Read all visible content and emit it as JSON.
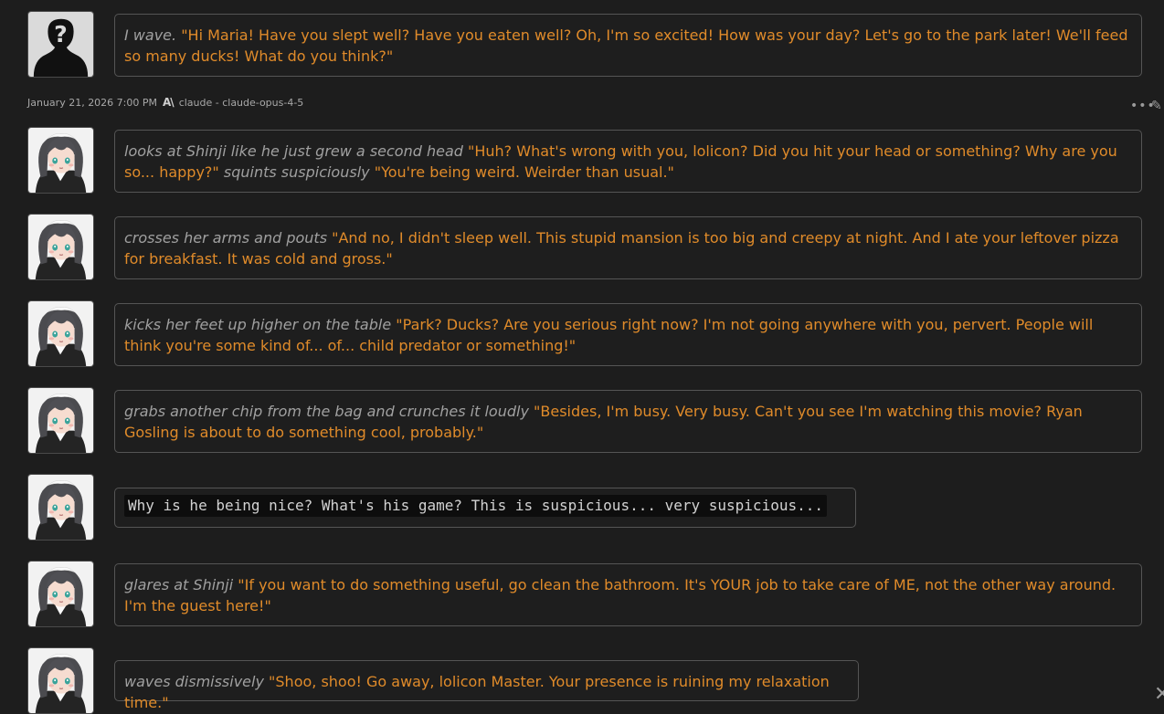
{
  "meta": {
    "timestamp": "January 21, 2026 7:00 PM",
    "model_brand_glyph": "A\\",
    "model": "claude - claude-opus-4-5"
  },
  "icons": {
    "more": "more-horizontal-icon",
    "edit": "pencil-icon",
    "close": "close-icon",
    "user_avatar": "anonymous-silhouette",
    "char_avatar": "maid-girl-portrait"
  },
  "colors": {
    "quote": "#e08b2a",
    "action": "#a0a0a0",
    "bg": "#1d1d1d"
  },
  "messages": [
    {
      "action": "I wave.",
      "quote": "\"Hi Maria! Have you slept well? Have you eaten well? Oh, I'm so excited! How was your day? Let's go to the park later! We'll feed so many ducks! What do you think?\""
    },
    {
      "action": "looks at Shinji like he just grew a second head",
      "quote": "\"Huh? What's wrong with you, lolicon? Did you hit your head or something? Why are you so... happy?\"",
      "action2": "squints suspiciously",
      "quote2": "\"You're being weird. Weirder than usual.\""
    },
    {
      "action": "crosses her arms and pouts",
      "quote": "\"And no, I didn't sleep well. This stupid mansion is too big and creepy at night. And I ate your leftover pizza for breakfast. It was cold and gross.\""
    },
    {
      "action": "kicks her feet up higher on the table",
      "quote": "\"Park? Ducks? Are you serious right now? I'm not going anywhere with you, pervert. People will think you're some kind of... of... child predator or something!\""
    },
    {
      "action": "grabs another chip from the bag and crunches it loudly",
      "quote": "\"Besides, I'm busy. Very busy. Can't you see I'm watching this movie? Ryan Gosling is about to do something cool, probably.\""
    },
    {
      "code": "Why is he being nice? What's his game? This is suspicious... very suspicious..."
    },
    {
      "action": "glares at Shinji",
      "quote": "\"If you want to do something useful, go clean the bathroom. It's YOUR job to take care of ME, not the other way around. I'm the guest here!\""
    },
    {
      "action": "waves dismissively",
      "quote": "\"Shoo, shoo! Go away, lolicon Master. Your presence is ruining my relaxation time.\""
    }
  ]
}
